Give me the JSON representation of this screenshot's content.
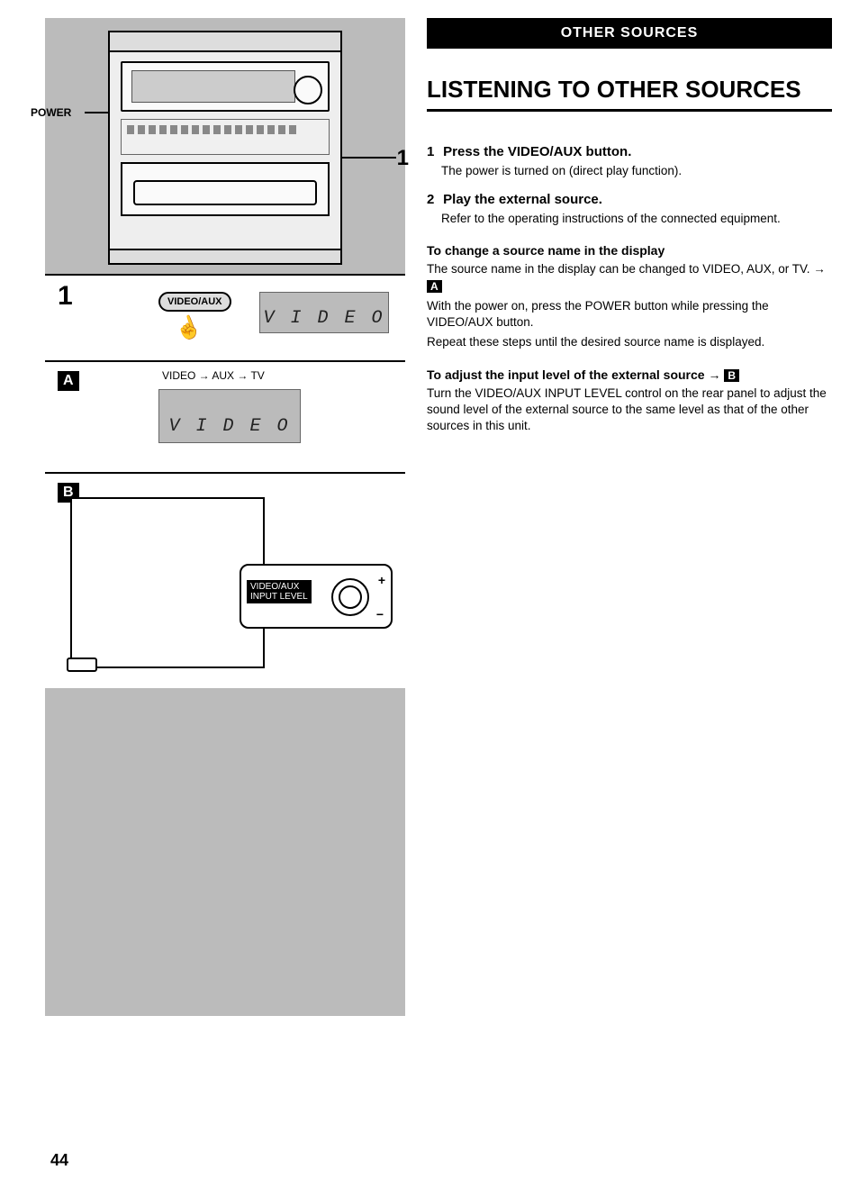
{
  "header_bar": "OTHER SOURCES",
  "title": "LISTENING TO OTHER SOURCES",
  "steps": [
    {
      "num": "1",
      "head": "Press the VIDEO/AUX button.",
      "body": "The power is turned on (direct play function)."
    },
    {
      "num": "2",
      "head": "Play the external source.",
      "body": "Refer to the operating instructions of the connected equipment."
    }
  ],
  "change_source": {
    "head": "To change a source name in the display",
    "p1a": "The source name in the display can be changed to VIDEO, AUX, or TV. →",
    "p1_ref": "A",
    "p2": "With the power on, press the POWER button while pressing the VIDEO/AUX button.",
    "p3": "Repeat these steps until the desired source name is displayed."
  },
  "adjust_level": {
    "head_a": "To adjust the input level of the external source →",
    "head_ref": "B",
    "body": "Turn the VIDEO/AUX INPUT LEVEL control on the rear panel to adjust the sound level of the external source to the same level as that of the other sources in this unit."
  },
  "illus": {
    "power": "POWER",
    "callout1": "1",
    "panel1_num": "1",
    "videoaux": "VIDEO/AUX",
    "lcd1": "V I D E O",
    "refA": "A",
    "cycle": "VIDEO → AUX → TV",
    "lcd2": "V I D E O",
    "refB": "B",
    "knob_label1": "VIDEO/AUX",
    "knob_label2": "INPUT LEVEL",
    "plus": "+",
    "minus": "−"
  },
  "page_num": "44"
}
